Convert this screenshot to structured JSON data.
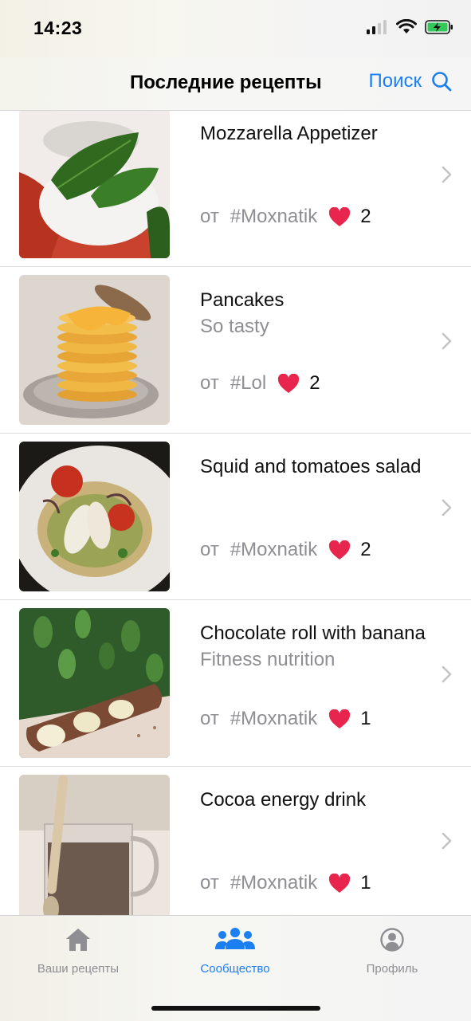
{
  "status_bar": {
    "time": "14:23"
  },
  "nav": {
    "title": "Последние рецепты",
    "search_label": "Поиск"
  },
  "author_prefix": "от",
  "recipes": [
    {
      "title": "Mozzarella Appetizer",
      "subtitle": "",
      "author": "#Moxnatik",
      "likes": "2"
    },
    {
      "title": "Pancakes",
      "subtitle": "So tasty",
      "author": "#Lol",
      "likes": "2"
    },
    {
      "title": "Squid and tomatoes salad",
      "subtitle": "",
      "author": "#Moxnatik",
      "likes": "2"
    },
    {
      "title": "Chocolate roll with banana",
      "subtitle": "Fitness nutrition",
      "author": "#Moxnatik",
      "likes": "1"
    },
    {
      "title": "Cocoa energy drink",
      "subtitle": "",
      "author": "#Moxnatik",
      "likes": "1"
    }
  ],
  "tabs": [
    {
      "label": "Ваши рецепты",
      "icon": "house-icon",
      "active": false
    },
    {
      "label": "Сообщество",
      "icon": "people-icon",
      "active": true
    },
    {
      "label": "Профиль",
      "icon": "person-circle-icon",
      "active": false
    }
  ],
  "colors": {
    "accent": "#1b7ff2",
    "heart": "#e8264d",
    "secondary_text": "#8e8e93",
    "inactive_tab": "#8e8e93"
  }
}
